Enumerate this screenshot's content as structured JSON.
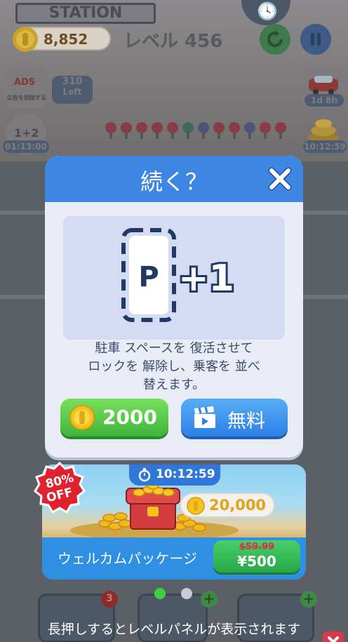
{
  "hud": {
    "coins": "8,852",
    "level": "レベル 456",
    "station_sign": "STATION"
  },
  "side_widgets": {
    "ads_label": "ADS",
    "ads_caption": "広告を削除する",
    "left_count": "310",
    "left_label": "Left",
    "bonus_label": "1+2",
    "bonus_timer": "01:13:00",
    "car_timer": "1d 8h",
    "chest_timer": "10:12:59"
  },
  "dialog": {
    "title": "続く？",
    "plus_label": "+1",
    "parking_letter": "P",
    "description_lines": [
      "駐車 スペースを 復活させて",
      "ロックを 解除し、乗客を 並べ",
      "替えます。"
    ],
    "coin_cost": "2000",
    "free_label": "無料"
  },
  "promo": {
    "discount_line1": "80%",
    "discount_line2": "OFF",
    "timer": "10:12:59",
    "reward": "20,000",
    "title": "ウェルカムパッケージ",
    "old_price": "$59.99",
    "price": "¥500"
  },
  "bottom": {
    "slot1_count": "3"
  },
  "hint": "長押しするとレベルパネルが表示されます",
  "colors": {
    "header_blue": "#3e86e3",
    "green_button": "#3fb43a",
    "blue_button": "#2d80e6",
    "price_gold": "#e3a117",
    "badge_red": "#d9394b"
  }
}
